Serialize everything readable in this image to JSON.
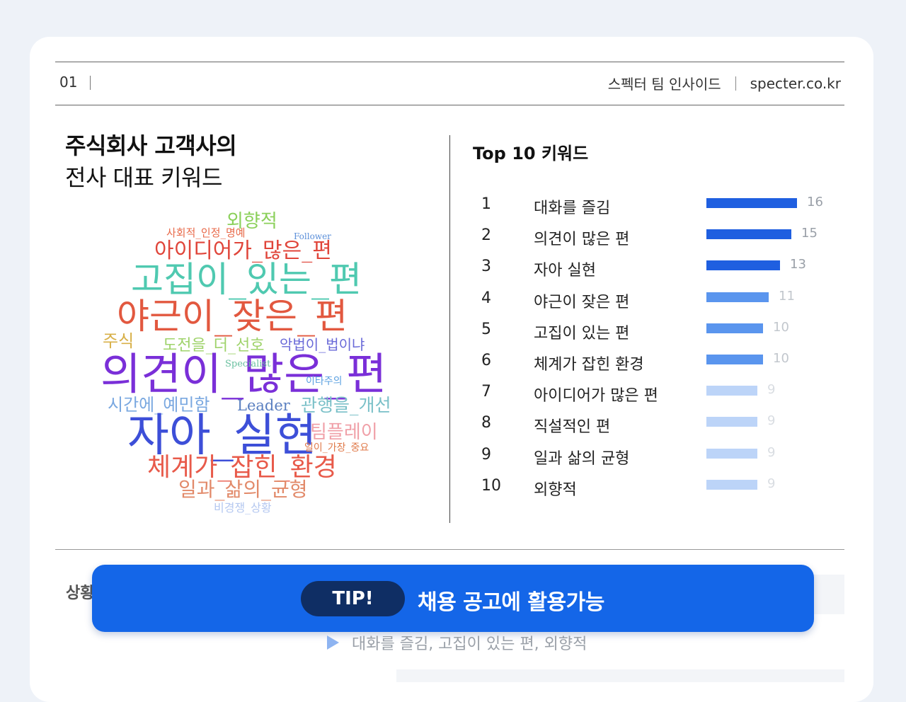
{
  "header": {
    "page_number": "01",
    "team_label": "스펙터 팀 인사이드",
    "site": "specter.co.kr"
  },
  "title": {
    "line1": "주식회사 고객사의",
    "line2": "전사 대표 키워드"
  },
  "top_keywords": {
    "title": "Top 10 키워드",
    "colors": {
      "strong": "#1f5fe0",
      "medium": "#5a95ee",
      "light": "#bcd4f8"
    },
    "items": [
      {
        "rank": "1",
        "label": "대화를 즐김",
        "value": 16,
        "tier": "strong"
      },
      {
        "rank": "2",
        "label": "의견이 많은 편",
        "value": 15,
        "tier": "strong"
      },
      {
        "rank": "3",
        "label": "자아 실현",
        "value": 13,
        "tier": "strong"
      },
      {
        "rank": "4",
        "label": "야근이 잦은 편",
        "value": 11,
        "tier": "medium"
      },
      {
        "rank": "5",
        "label": "고집이 있는 편",
        "value": 10,
        "tier": "medium"
      },
      {
        "rank": "6",
        "label": "체계가 잡힌 환경",
        "value": 10,
        "tier": "medium"
      },
      {
        "rank": "7",
        "label": "아이디어가 많은 편",
        "value": 9,
        "tier": "light"
      },
      {
        "rank": "8",
        "label": "직설적인 편",
        "value": 9,
        "tier": "light"
      },
      {
        "rank": "9",
        "label": "일과 삶의 균형",
        "value": 9,
        "tier": "light"
      },
      {
        "rank": "10",
        "label": "외향적",
        "value": 9,
        "tier": "light"
      }
    ]
  },
  "word_cloud": [
    {
      "text": "외향적",
      "color": "#8bd05a"
    },
    {
      "text": "사회적_인정_명예",
      "color": "#e86a4a"
    },
    {
      "text": "Follower",
      "color": "#5b8fd9"
    },
    {
      "text": "아이디어가_많은_편",
      "color": "#e0453a"
    },
    {
      "text": "고집이_있는_편",
      "color": "#4fc9b0"
    },
    {
      "text": "야근이_잦은_편",
      "color": "#e2583f"
    },
    {
      "text": "주식",
      "color": "#d8b048"
    },
    {
      "text": "도전을_더_선호",
      "color": "#9fd36b"
    },
    {
      "text": "악법이_법이냐",
      "color": "#6a6ad8"
    },
    {
      "text": "의견이_많은_편",
      "color": "#7a2fd8"
    },
    {
      "text": "Specialist",
      "color": "#6ac0a0"
    },
    {
      "text": "이타주의",
      "color": "#5aa0e0"
    },
    {
      "text": "시간에_예민함",
      "color": "#7aa8e0"
    },
    {
      "text": "Leader",
      "color": "#5a7fc0"
    },
    {
      "text": "관행을_개선",
      "color": "#7ac0c8"
    },
    {
      "text": "자아_실현",
      "color": "#3d4fd8"
    },
    {
      "text": "팀플레이",
      "color": "#f0a0a8"
    },
    {
      "text": "일이_가장_중요",
      "color": "#e07a4a"
    },
    {
      "text": "체계가_잡힌_환경",
      "color": "#e85a4a"
    },
    {
      "text": "일과_삶의_균형",
      "color": "#e28a6a"
    },
    {
      "text": "비경쟁_상황",
      "color": "#b5c8f0"
    }
  ],
  "bottom": {
    "section_label": "상황",
    "tip_badge": "TIP!",
    "tip_text": "채용 공고에 활용가능",
    "faded_text": "대화를 즐김, 고집이 있는 편, 외향적"
  }
}
